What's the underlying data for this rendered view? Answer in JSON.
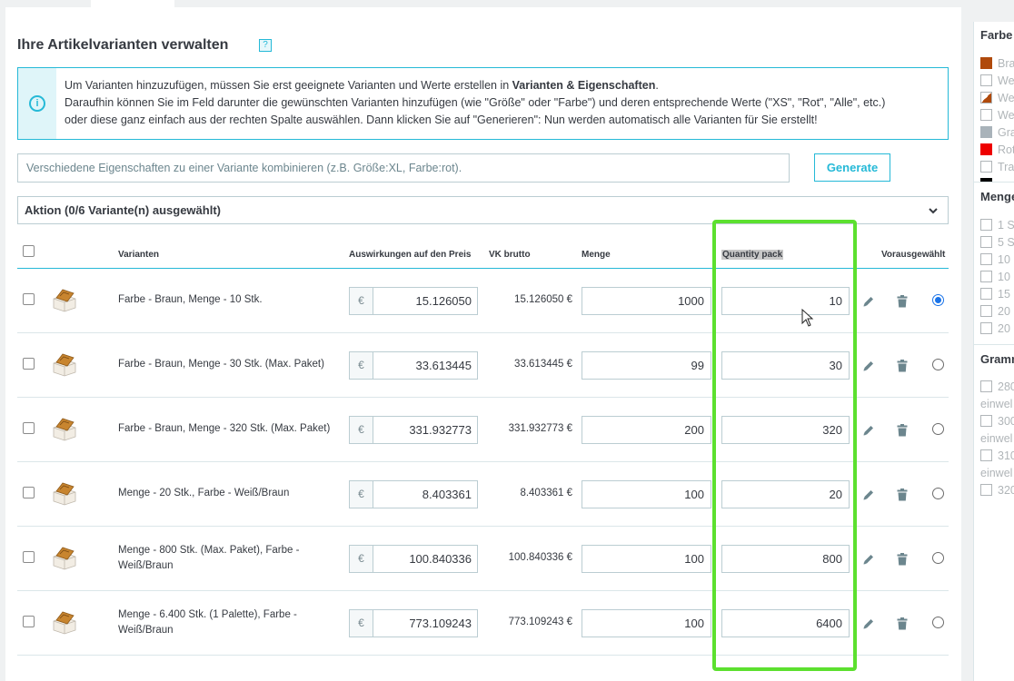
{
  "page": {
    "title": "Ihre Artikelvarianten verwalten",
    "help_icon": "?"
  },
  "info": {
    "icon": "i",
    "line1_pre": "Um Varianten hinzuzufügen, müssen Sie erst geeignete Varianten und Werte erstellen in ",
    "line1_bold": "Varianten & Eigenschaften",
    "line1_post": ".",
    "line2": "Daraufhin können Sie im Feld darunter die gewünschten Varianten hinzufügen (wie \"Größe\" oder \"Farbe\") und deren entsprechende Werte (\"XS\", \"Rot\", \"Alle\", etc.)",
    "line3": "oder diese ganz einfach aus der rechten Spalte auswählen. Dann klicken Sie auf \"Generieren\": Nun werden automatisch alle Varianten für Sie erstellt!"
  },
  "combine": {
    "placeholder": "Verschiedene Eigenschaften zu einer Variante kombinieren (z.B. Größe:XL, Farbe:rot).",
    "generate_label": "Generate"
  },
  "action": {
    "label": "Aktion (0/6 Variante(n) ausgewählt)",
    "chevron": "⌄"
  },
  "columns": {
    "variants": "Varianten",
    "impact": "Auswirkungen auf den Preis",
    "gross": "VK brutto",
    "quantity": "Menge",
    "quantity_pack": "Quantity pack",
    "default": "Vorausgewählt"
  },
  "rows": [
    {
      "name": "Farbe - Braun, Menge - 10 Stk.",
      "currency": "€",
      "price": "15.126050",
      "gross": "15.126050 €",
      "quantity": "1000",
      "pack": "10",
      "default": true
    },
    {
      "name": "Farbe - Braun, Menge - 30 Stk. (Max. Paket)",
      "currency": "€",
      "price": "33.613445",
      "gross": "33.613445 €",
      "quantity": "99",
      "pack": "30",
      "default": false
    },
    {
      "name": "Farbe - Braun, Menge - 320 Stk. (Max. Paket)",
      "currency": "€",
      "price": "331.932773",
      "gross": "331.932773 €",
      "quantity": "200",
      "pack": "320",
      "default": false
    },
    {
      "name": "Menge - 20 Stk., Farbe - Weiß/Braun",
      "currency": "€",
      "price": "8.403361",
      "gross": "8.403361 €",
      "quantity": "100",
      "pack": "20",
      "default": false
    },
    {
      "name": "Menge - 800 Stk. (Max. Paket), Farbe - Weiß/Braun",
      "currency": "€",
      "price": "100.840336",
      "gross": "100.840336 €",
      "quantity": "100",
      "pack": "800",
      "default": false
    },
    {
      "name": "Menge - 6.400 Stk. (1 Palette), Farbe - Weiß/Braun",
      "currency": "€",
      "price": "773.109243",
      "gross": "773.109243 €",
      "quantity": "100",
      "pack": "6400",
      "default": false
    }
  ],
  "sidebar": {
    "farbe_title": "Farbe",
    "farbe_items": [
      {
        "label": "Bra",
        "color": "#b04a0c"
      },
      {
        "label": "We",
        "color": "#ffffff"
      },
      {
        "label": "We",
        "color": "diagonal"
      },
      {
        "label": "We",
        "color": "#ffffff"
      },
      {
        "label": "Gra",
        "color": "#a9b3ba"
      },
      {
        "label": "Rot",
        "color": "#ee0000"
      },
      {
        "label": "Tra",
        "color": "#ffffff"
      }
    ],
    "menge_title": "Menge",
    "menge_items": [
      "1 S",
      "5 S",
      "10",
      "10",
      "15",
      "20",
      "20"
    ],
    "gramm_title": "Gramm",
    "gramm_items": [
      "280",
      "einwel",
      "300",
      "einwel",
      "310",
      "einwel",
      "320"
    ]
  }
}
